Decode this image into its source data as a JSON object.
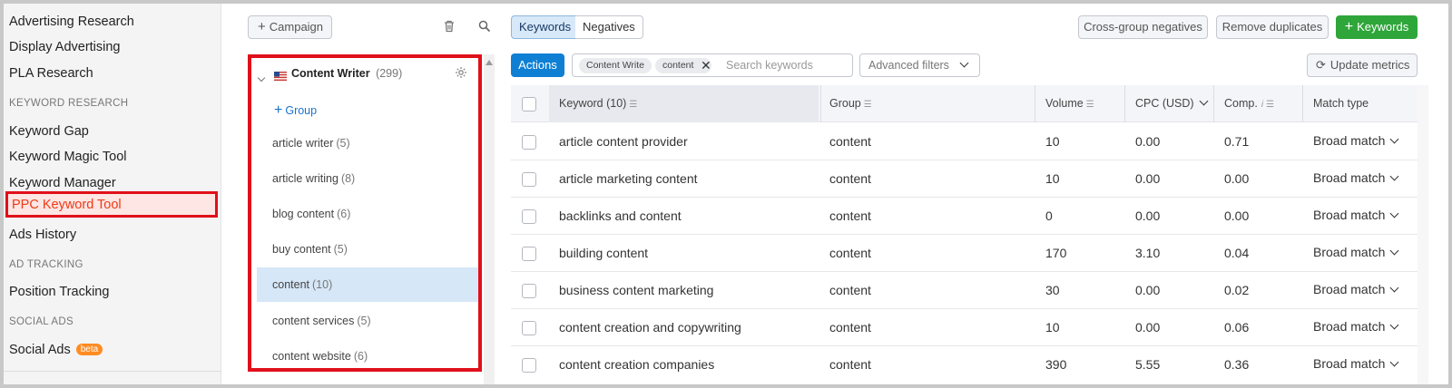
{
  "nav": {
    "items_top": [
      "Advertising Research",
      "Display Advertising",
      "PLA Research"
    ],
    "section_keyword": "KEYWORD RESEARCH",
    "items_keyword": [
      "Keyword Gap",
      "Keyword Magic Tool",
      "Keyword Manager"
    ],
    "active_item": "PPC Keyword Tool",
    "ads_history": "Ads History",
    "section_tracking": "AD TRACKING",
    "position_tracking": "Position Tracking",
    "section_social": "SOCIAL ADS",
    "social_ads": "Social Ads",
    "social_badge": "beta"
  },
  "groups": {
    "campaign_button": "Campaign",
    "campaign_name": "Content Writer",
    "campaign_count": "(299)",
    "add_group": "Group",
    "items": [
      {
        "name": "article writer",
        "count": "(5)"
      },
      {
        "name": "article writing",
        "count": "(8)"
      },
      {
        "name": "blog content",
        "count": "(6)"
      },
      {
        "name": "buy content",
        "count": "(5)"
      },
      {
        "name": "content",
        "count": "(10)"
      },
      {
        "name": "content services",
        "count": "(5)"
      },
      {
        "name": "content website",
        "count": "(6)"
      }
    ]
  },
  "toolbar": {
    "tab_keywords": "Keywords",
    "tab_negatives": "Negatives",
    "cross_group": "Cross-group negatives",
    "remove_duplicates": "Remove duplicates",
    "add_keywords": "Keywords",
    "actions": "Actions",
    "chip1": "Content Write",
    "chip2": "content",
    "search_placeholder": "Search keywords",
    "advanced_filters": "Advanced filters",
    "update_metrics": "Update metrics"
  },
  "table": {
    "headers": {
      "keyword": "Keyword (10)",
      "group": "Group",
      "volume": "Volume",
      "cpc": "CPC (USD)",
      "comp": "Comp.",
      "match": "Match type"
    },
    "rows": [
      {
        "keyword": "article content provider",
        "group": "content",
        "volume": "10",
        "cpc": "0.00",
        "comp": "0.71",
        "match": "Broad match"
      },
      {
        "keyword": "article marketing content",
        "group": "content",
        "volume": "10",
        "cpc": "0.00",
        "comp": "0.00",
        "match": "Broad match"
      },
      {
        "keyword": "backlinks and content",
        "group": "content",
        "volume": "0",
        "cpc": "0.00",
        "comp": "0.00",
        "match": "Broad match"
      },
      {
        "keyword": "building content",
        "group": "content",
        "volume": "170",
        "cpc": "3.10",
        "comp": "0.04",
        "match": "Broad match"
      },
      {
        "keyword": "business content marketing",
        "group": "content",
        "volume": "30",
        "cpc": "0.00",
        "comp": "0.02",
        "match": "Broad match"
      },
      {
        "keyword": "content creation and copywriting",
        "group": "content",
        "volume": "10",
        "cpc": "0.00",
        "comp": "0.06",
        "match": "Broad match"
      },
      {
        "keyword": "content creation companies",
        "group": "content",
        "volume": "390",
        "cpc": "5.55",
        "comp": "0.36",
        "match": "Broad match"
      }
    ]
  },
  "colors": {
    "highlight_red": "#e0101a",
    "accent_blue": "#0f7fd4",
    "accent_green": "#2fa63a",
    "active_text": "#ee3a17"
  }
}
